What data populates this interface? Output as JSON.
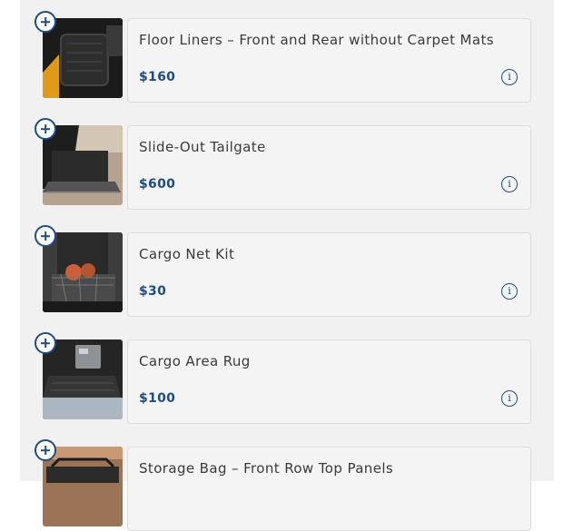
{
  "accessories": [
    {
      "name": "Floor Liners – Front and Rear without Carpet Mats",
      "price": "$160",
      "image_icon": "floor-liner-image"
    },
    {
      "name": "Slide-Out Tailgate",
      "price": "$600",
      "image_icon": "tailgate-image"
    },
    {
      "name": "Cargo Net Kit",
      "price": "$30",
      "image_icon": "cargo-net-image"
    },
    {
      "name": "Cargo Area Rug",
      "price": "$100",
      "image_icon": "cargo-rug-image"
    },
    {
      "name": "Storage Bag – Front Row Top Panels",
      "price": "",
      "image_icon": "storage-bag-image"
    }
  ],
  "icons": {
    "add": "plus-icon",
    "info": "info-icon"
  },
  "colors": {
    "accent": "#1f4d82",
    "panel_bg": "#f1f1f1",
    "card_border": "#dcdcdc"
  }
}
